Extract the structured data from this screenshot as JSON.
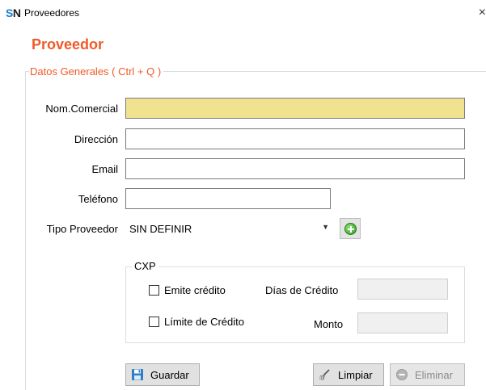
{
  "window": {
    "logo": {
      "s": "S",
      "n": "N"
    },
    "title": "Proveedores",
    "close_glyph": "×"
  },
  "form": {
    "heading": "Proveedor",
    "group_title": "Datos Generales ( Ctrl + Q )",
    "fields": {
      "nom_comercial": {
        "label": "Nom.Comercial",
        "value": ""
      },
      "direccion": {
        "label": "Dirección",
        "value": ""
      },
      "email": {
        "label": "Email",
        "value": ""
      },
      "telefono": {
        "label": "Teléfono",
        "value": ""
      },
      "tipo_proveedor": {
        "label": "Tipo Proveedor",
        "selected": "SIN DEFINIR"
      }
    },
    "add_button_icon": "plus-circle-icon",
    "cxp": {
      "title": "CXP",
      "emite_credito": {
        "label": "Emite crédito",
        "checked": false
      },
      "dias_credito": {
        "label": "Días de Crédito",
        "value": ""
      },
      "limite_credito": {
        "label": "Límite de Crédito",
        "checked": false
      },
      "monto": {
        "label": "Monto",
        "value": ""
      }
    },
    "buttons": {
      "guardar": "Guardar",
      "limpiar": "Limpiar",
      "eliminar": "Eliminar"
    }
  },
  "colors": {
    "accent": "#f05a28",
    "active_field": "#f0e38f",
    "logo_s": "#1a7fd1"
  }
}
